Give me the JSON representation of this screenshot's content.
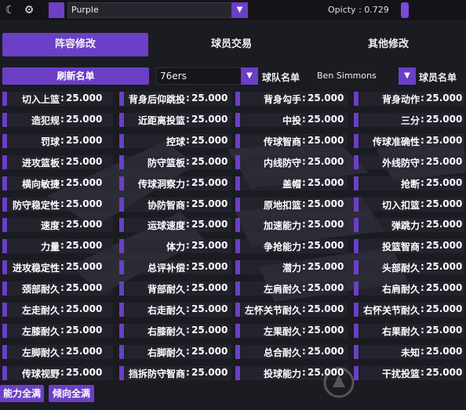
{
  "header": {
    "theme_value": "Purple",
    "opacity_label": "Opicty : 0.729",
    "opacity": 0.729
  },
  "tabs": [
    {
      "label": "阵容修改",
      "active": true
    },
    {
      "label": "球员交易",
      "active": false
    },
    {
      "label": "其他修改",
      "active": false
    }
  ],
  "toolbar": {
    "refresh_label": "刷新名单",
    "team_value": "76ers",
    "team_list_label": "球队名单",
    "player_value": "Ben Simmons",
    "player_list_label": "球员名单"
  },
  "attributes": [
    [
      "切入上篮",
      "背身后仰跳投",
      "背身勾手",
      "背身动作"
    ],
    [
      "造犯规",
      "近距离投篮",
      "中投",
      "三分"
    ],
    [
      "罚球",
      "控球",
      "传球智商",
      "传球准确性"
    ],
    [
      "进攻篮板",
      "防守篮板",
      "内线防守",
      "外线防守"
    ],
    [
      "横向敏捷",
      "传球洞察力",
      "盖帽",
      "抢断"
    ],
    [
      "防守稳定性",
      "协防智商",
      "原地扣篮",
      "切入扣篮"
    ],
    [
      "速度",
      "运球速度",
      "加速能力",
      "弹跳力"
    ],
    [
      "力量",
      "体力",
      "争抢能力",
      "投篮智商"
    ],
    [
      "进攻稳定性",
      "总评补偿",
      "潜力",
      "头部耐久"
    ],
    [
      "颈部耐久",
      "背部耐久",
      "左肩耐久",
      "右肩耐久"
    ],
    [
      "左走耐久",
      "右走耐久",
      "左怀关节耐久",
      "右怀关节耐久"
    ],
    [
      "左膝耐久",
      "右膝耐久",
      "左果耐久",
      "右果耐久"
    ],
    [
      "左脚耐久",
      "右脚耐久",
      "总合耐久",
      "未知"
    ],
    [
      "传球视野",
      "挡拆防守智商",
      "投球能力",
      "干扰投篮"
    ]
  ],
  "attribute_value": "25.000",
  "bottom": {
    "max_ability_label": "能力全满",
    "max_tendency_label": "倾向全满"
  },
  "colors": {
    "accent": "#6b3fc6",
    "background": "#1b1b22"
  }
}
